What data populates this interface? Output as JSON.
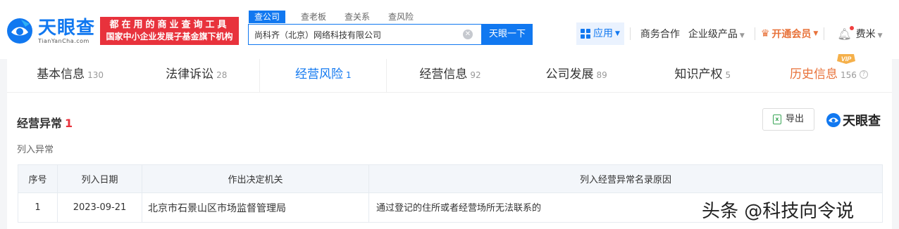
{
  "header": {
    "logo_cn": "天眼查",
    "logo_en": "TianYanCha.com",
    "slogan_line1": "都在用的商业查询工具",
    "slogan_line2": "国家中小企业发展子基金旗下机构",
    "search_tabs": [
      "查公司",
      "查老板",
      "查关系",
      "查风险"
    ],
    "search_value": "尚科齐（北京）网络科技有限公司",
    "search_button": "天眼一下",
    "nav": {
      "apps": "应用",
      "business": "商务合作",
      "enterprise": "企业级产品",
      "vip": "开通会员",
      "user": "费米"
    }
  },
  "tabs": [
    {
      "label": "基本信息",
      "count": "130"
    },
    {
      "label": "法律诉讼",
      "count": "28"
    },
    {
      "label": "经营风险",
      "count": "1"
    },
    {
      "label": "经营信息",
      "count": "92"
    },
    {
      "label": "公司发展",
      "count": "89"
    },
    {
      "label": "知识产权",
      "count": "5"
    },
    {
      "label": "历史信息",
      "count": "156"
    }
  ],
  "vip_badge": "VIP",
  "section": {
    "title": "经营异常",
    "count": "1",
    "export_label": "导出",
    "brand": "天眼查",
    "sub_label": "列入异常"
  },
  "table": {
    "headers": [
      "序号",
      "列入日期",
      "作出决定机关",
      "列入经营异常名录原因"
    ],
    "rows": [
      [
        "1",
        "2023-09-21",
        "北京市石景山区市场监督管理局",
        "通过登记的住所或者经营场所无法联系的"
      ]
    ]
  },
  "watermark": "头条 @科技向令说",
  "colors": {
    "brand_blue": "#1178f0",
    "slogan_red": "#e8323c",
    "vip_orange": "#e8723a"
  }
}
